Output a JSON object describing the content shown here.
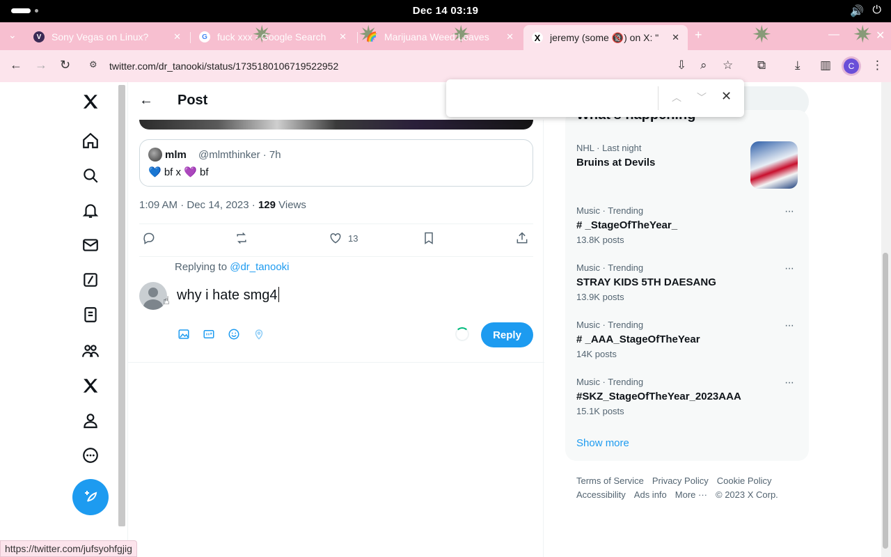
{
  "os": {
    "clock": "Dec 14  03:19"
  },
  "tabs": [
    {
      "title": "Sony Vegas on Linux?",
      "favicon": "V",
      "favicon_color": "#3b2a55"
    },
    {
      "title": "fuck xxx - Google Search",
      "favicon": "G",
      "favicon_color": "#ffffff"
    },
    {
      "title": "Marijuana Weed Leaves",
      "favicon": "🌈",
      "favicon_color": "transparent"
    },
    {
      "title": "jeremy (some 🔞) on X: \"",
      "favicon": "X",
      "favicon_color": "#000000"
    }
  ],
  "address": {
    "url": "twitter.com/dr_tanooki/status/1735180106719522952"
  },
  "profile_initial": "C",
  "post": {
    "header_title": "Post",
    "quote": {
      "name": "mlm",
      "handle": "@mlmthinker · 7h",
      "text": "💙 bf x 💜 bf"
    },
    "meta_time": "1:09 AM · Dec 14, 2023 · ",
    "meta_views_count": "129",
    "meta_views_label": " Views",
    "like_count": "13",
    "replying_prefix": "Replying to ",
    "replying_handle": "@dr_tanooki",
    "compose_text": "why i hate smg4",
    "reply_button": "Reply"
  },
  "sidebar": {
    "trends_title": "What's happening",
    "trends": [
      {
        "context": "NHL · Last night",
        "name": "Bruins at Devils",
        "count": ""
      },
      {
        "context": "Music · Trending",
        "name": "#      _StageOfTheYear_",
        "count": "13.8K posts"
      },
      {
        "context": "Music · Trending",
        "name": "STRAY KIDS 5TH DAESANG",
        "count": "13.9K posts"
      },
      {
        "context": "Music · Trending",
        "name": "#      _AAA_StageOfTheYear",
        "count": "14K posts"
      },
      {
        "context": "Music · Trending",
        "name": "#SKZ_StageOfTheYear_2023AAA",
        "count": "15.1K posts"
      }
    ],
    "show_more": "Show more",
    "footer": {
      "terms": "Terms of Service",
      "privacy": "Privacy Policy",
      "cookie": "Cookie Policy",
      "accessibility": "Accessibility",
      "ads": "Ads info",
      "more": "More ···",
      "copyright": "© 2023 X Corp."
    }
  },
  "find": {
    "value": ""
  },
  "status_link": "https://twitter.com/jufsyohfgjig",
  "colors": {
    "accent": "#1d9bf0",
    "tabstrip": "#f7bfd0",
    "toolbar": "#fce4ec"
  }
}
